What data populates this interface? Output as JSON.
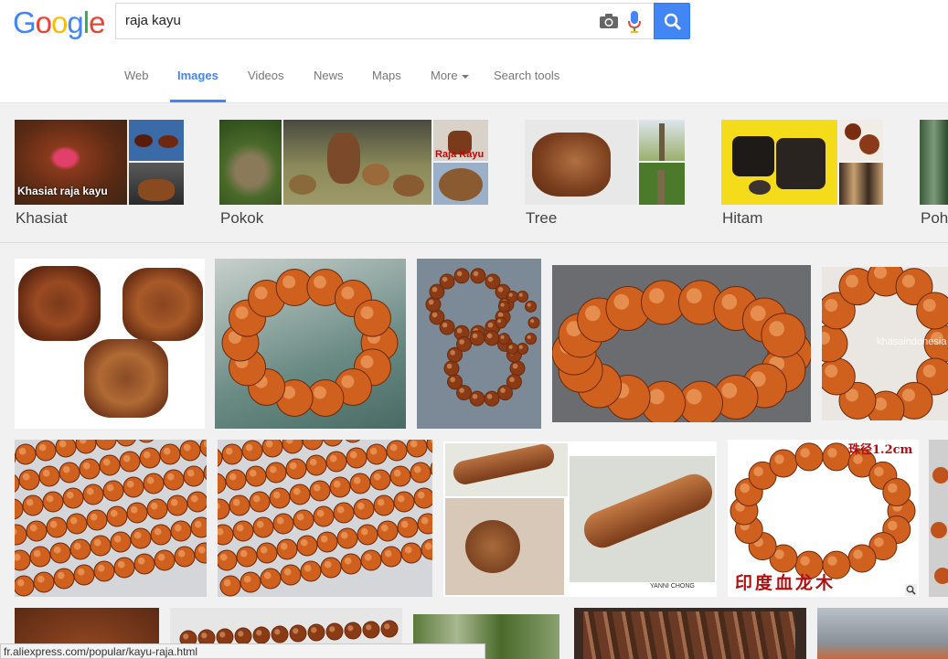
{
  "brand": {
    "logo_letters": [
      {
        "ch": "G",
        "color": "#4285f4"
      },
      {
        "ch": "o",
        "color": "#ea4335"
      },
      {
        "ch": "o",
        "color": "#fbbc05"
      },
      {
        "ch": "g",
        "color": "#4285f4"
      },
      {
        "ch": "l",
        "color": "#34a853"
      },
      {
        "ch": "e",
        "color": "#ea4335"
      }
    ]
  },
  "search": {
    "query": "raja kayu",
    "camera_icon": "camera-icon",
    "mic_icon": "microphone-icon",
    "button_icon": "magnifier-icon",
    "button_color": "#4285f4"
  },
  "tabs": [
    {
      "label": "Web",
      "active": false
    },
    {
      "label": "Images",
      "active": true
    },
    {
      "label": "Videos",
      "active": false
    },
    {
      "label": "News",
      "active": false
    },
    {
      "label": "Maps",
      "active": false
    },
    {
      "label": "More",
      "active": false
    },
    {
      "label": "Search tools",
      "active": false
    }
  ],
  "related": [
    {
      "label": "Khasiat",
      "overlay": "Khasiat raja kayu"
    },
    {
      "label": "Pokok",
      "overlay": "Raja Kayu"
    },
    {
      "label": "Tree"
    },
    {
      "label": "Hitam"
    },
    {
      "label": "Poh"
    }
  ],
  "watermarks": {
    "kh": "khasaindonesia",
    "cn_top": "珠径1.2cm",
    "cn_bottom": "印度血龙木",
    "author": "YANNI CHONG"
  },
  "status_bar": {
    "url": "fr.aliexpress.com/popular/kayu-raja.html"
  },
  "colors": {
    "accent": "#4285f4",
    "wood": "#c8561e",
    "wood_dark": "#7a2c0c"
  }
}
